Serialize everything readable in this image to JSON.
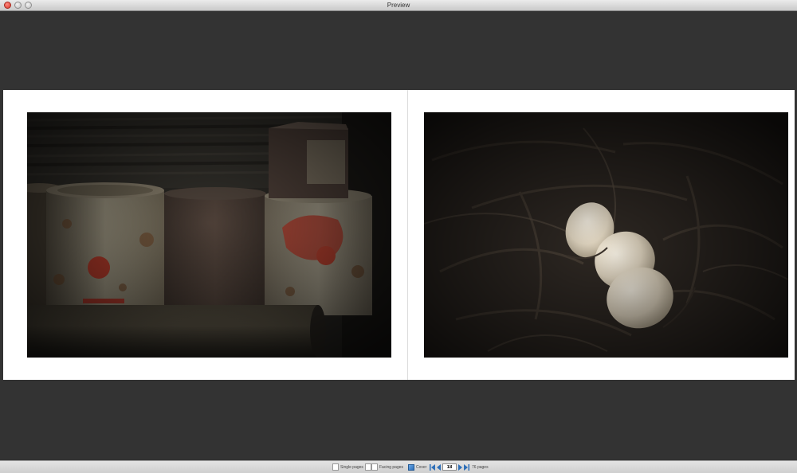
{
  "window": {
    "title": "Preview"
  },
  "toolbar": {
    "single_pages_label": "Single pages",
    "facing_pages_label": "Facing pages",
    "cover_label": "Cover",
    "current_page": "18",
    "total_pages_label": "76 pages"
  },
  "colors": {
    "background": "#333333",
    "page": "#ffffff",
    "accent": "#2e6fb8"
  },
  "icons": {
    "first_page": "skip-to-first-icon",
    "prev_page": "previous-page-icon",
    "next_page": "next-page-icon",
    "last_page": "skip-to-last-icon",
    "cover": "cover-icon"
  }
}
